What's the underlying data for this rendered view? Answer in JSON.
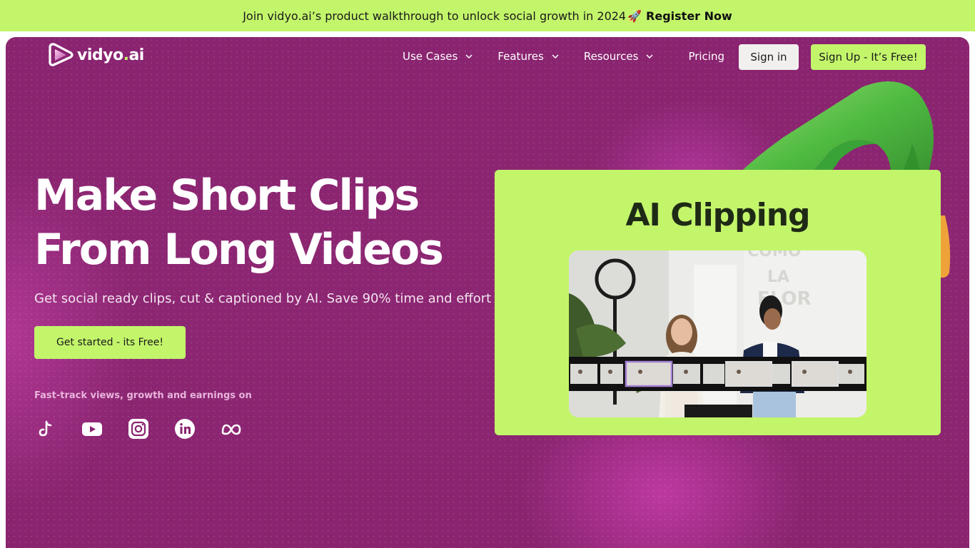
{
  "banner": {
    "text": "Join vidyo.ai’s product walkthrough to unlock social growth in 2024",
    "emoji": "🚀",
    "cta": "Register Now"
  },
  "nav": {
    "logo_text_main": "vidyo",
    "logo_text_dot": ".",
    "logo_text_ai": "ai",
    "items": [
      {
        "label": "Use Cases",
        "dropdown": true
      },
      {
        "label": "Features",
        "dropdown": true
      },
      {
        "label": "Resources",
        "dropdown": true
      },
      {
        "label": "Pricing",
        "dropdown": false
      }
    ],
    "signin": "Sign in",
    "signup": "Sign Up - It’s Free!"
  },
  "hero": {
    "headline_line1": "Make Short Clips",
    "headline_line2": "From Long Videos",
    "subhead": "Get social ready clips, cut & captioned by AI. Save 90% time and effort",
    "cta": "Get started - its Free!",
    "fasttrack": "Fast-track views, growth and earnings on",
    "socials": [
      "tiktok-icon",
      "youtube-icon",
      "instagram-icon",
      "linkedin-icon",
      "meta-icon"
    ]
  },
  "feature_card": {
    "title": "AI Clipping",
    "wall_text": [
      "COMO",
      "LA",
      "FLOR"
    ]
  },
  "colors": {
    "accent": "#c3f56b",
    "hero_bg": "#8a2470",
    "text_dark": "#1a1a1a"
  }
}
